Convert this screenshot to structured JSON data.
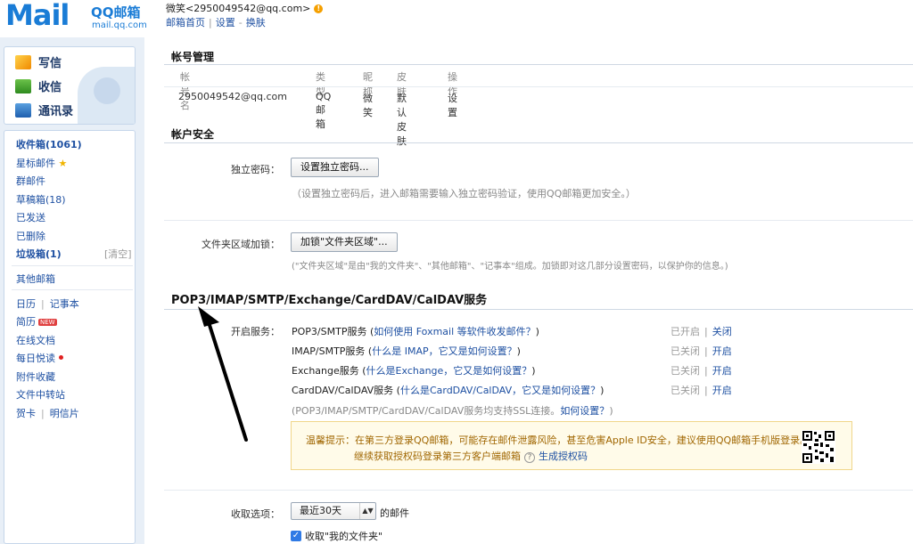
{
  "header": {
    "logo_text": "Mail",
    "brand_cn": "QQ邮箱",
    "brand_url": "mail.qq.com",
    "user": "微笑<2950049542@qq.com>",
    "links": [
      "邮箱首页",
      "设置",
      "换肤"
    ]
  },
  "topnav": [
    "写信",
    "收信",
    "通讯录"
  ],
  "folders": {
    "inbox": "收件箱(1061)",
    "starred": "星标邮件",
    "group": "群邮件",
    "drafts": "草稿箱(18)",
    "sent": "已发送",
    "deleted": "已删除",
    "spam": "垃圾箱(1)",
    "clear": "[清空]",
    "other": "其他邮箱",
    "calendar": "日历",
    "notes": "记事本",
    "resume": "简历",
    "resume_badge": "NEW",
    "docs": "在线文档",
    "daily": "每日悦读",
    "attachments": "附件收藏",
    "transfer": "文件中转站",
    "cards": "贺卡",
    "postcards": "明信片"
  },
  "accounts": {
    "title": "帐号管理",
    "headers": [
      "帐号名",
      "类型",
      "昵称",
      "皮肤",
      "操作"
    ],
    "row": [
      "2950049542@qq.com",
      "QQ邮箱",
      "微笑",
      "默认皮肤",
      "设置"
    ]
  },
  "security": {
    "title": "帐户安全",
    "pwd_label": "独立密码：",
    "pwd_button": "设置独立密码...",
    "pwd_note": "（设置独立密码后，进入邮箱需要输入独立密码验证，使用QQ邮箱更加安全。）",
    "lock_label": "文件夹区域加锁：",
    "lock_button": "加锁\"文件夹区域\"...",
    "lock_note": "(\"文件夹区域\"是由\"我的文件夹\"、\"其他邮箱\"、\"记事本\"组成。加锁即对这几部分设置密码，以保护你的信息。)"
  },
  "services": {
    "title": "POP3/IMAP/SMTP/Exchange/CardDAV/CalDAV服务",
    "label": "开启服务：",
    "items": [
      {
        "name": "POP3/SMTP服务 (",
        "help": "如何使用 Foxmail 等软件收发邮件？",
        "end": ")",
        "status": "已开启",
        "action": "关闭"
      },
      {
        "name": "IMAP/SMTP服务 (",
        "help": "什么是 IMAP，它又是如何设置？",
        "end": ")",
        "status": "已关闭",
        "action": "开启"
      },
      {
        "name": "Exchange服务 (",
        "help": "什么是Exchange，它又是如何设置？",
        "end": ")",
        "status": "已关闭",
        "action": "开启"
      },
      {
        "name": "CardDAV/CalDAV服务 (",
        "help": "什么是CardDAV/CalDAV，它又是如何设置？",
        "end": ")",
        "status": "已关闭",
        "action": "开启"
      }
    ],
    "ssl_note": "(POP3/IMAP/SMTP/CardDAV/CalDAV服务均支持SSL连接。",
    "ssl_link": "如何设置？",
    "ssl_end": ")",
    "tip_line1": "温馨提示：在第三方登录QQ邮箱，可能存在邮件泄露风险，甚至危害Apple ID安全，建议使用QQ邮箱手机版登录。",
    "tip_line2": "继续获取授权码登录第三方客户端邮箱",
    "tip_link": "生成授权码"
  },
  "receive": {
    "label": "收取选项：",
    "select": "最近30天",
    "suffix": "的邮件",
    "checkbox": "收取\"我的文件夹\""
  }
}
